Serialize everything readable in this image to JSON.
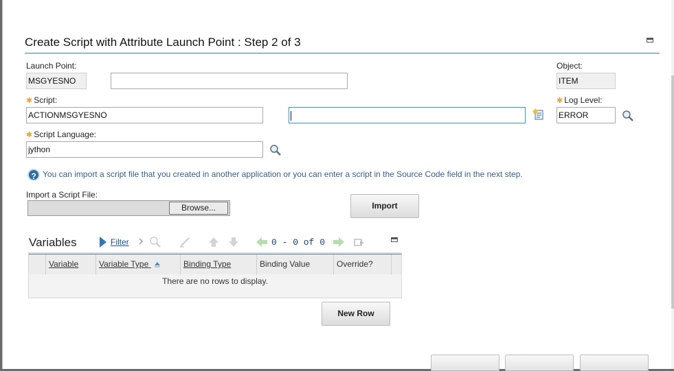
{
  "dialog": {
    "title": "Create Script with Attribute Launch Point : Step 2 of 3"
  },
  "form": {
    "launch_point": {
      "label": "Launch Point:",
      "value": "MSGYESNO",
      "description": ""
    },
    "object": {
      "label": "Object:",
      "value": "ITEM"
    },
    "script": {
      "label": "Script:",
      "value": "ACTIONMSGYESNO",
      "description": ""
    },
    "log_level": {
      "label": "Log Level:",
      "value": "ERROR"
    },
    "script_language": {
      "label": "Script Language:",
      "value": "jython"
    },
    "required_marker": "✱"
  },
  "info_message": "You can import a script file that you created in another application or you can enter a script in the Source Code field in the next step.",
  "import": {
    "label": "Import a Script File:",
    "browse_label": "Browse...",
    "import_button": "Import"
  },
  "variables": {
    "title": "Variables",
    "filter_label": "Filter",
    "pagination": "0 - 0 of 0",
    "columns": [
      "Variable",
      "Variable Type",
      "Binding Type",
      "Binding Value",
      "Override?"
    ],
    "empty_message": "There are no rows to display.",
    "new_row_button": "New Row"
  },
  "colors": {
    "accent": "#3c7a9a",
    "required": "#e8a23a",
    "info_text": "#3a5e84"
  }
}
